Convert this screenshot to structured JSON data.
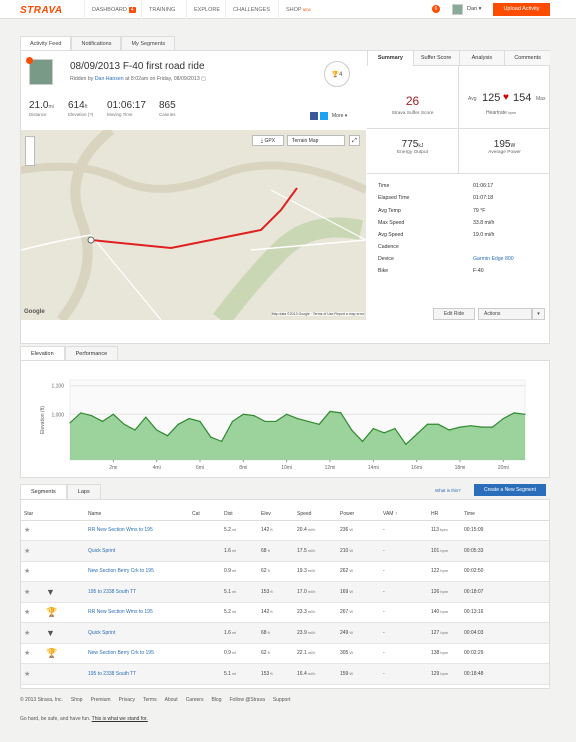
{
  "header": {
    "logo": "STRAVA",
    "nav": [
      "DASHBOARD",
      "TRAINING",
      "EXPLORE",
      "CHALLENGES",
      "SHOP"
    ],
    "dashboard_badge": "4",
    "shop_badge": "NEW",
    "notifications": "6",
    "user": "Dan ▾",
    "upload": "Upload Activity"
  },
  "tabs": [
    "Activity Feed",
    "Notifications",
    "My Segments"
  ],
  "activity": {
    "title": "08/09/2013 F-40 first road ride",
    "ridden_by_prefix": "Ridden by",
    "rider": "Dan Hansen",
    "ridden_by_suffix": "at 8:02am on Friday, 08/09/2013",
    "kudos": "4",
    "more": "More ▾",
    "stats": [
      {
        "value": "21.0",
        "unit": "mi",
        "label": "Distance"
      },
      {
        "value": "614",
        "unit": "ft",
        "label": "Elevation (?)"
      },
      {
        "value": "01:06:17",
        "unit": "",
        "label": "Moving Time"
      },
      {
        "value": "865",
        "unit": "",
        "label": "Calories"
      }
    ]
  },
  "map": {
    "gpx": "GPX",
    "type": "Terrain Map",
    "copyright": "Map data ©2013 Google · Terms of Use   Report a map error",
    "google": "Google"
  },
  "right_tabs": [
    "Summary",
    "Suffer Score",
    "Analysis",
    "Comments"
  ],
  "summary": {
    "suffer": "26",
    "suffer_label": "Strava Suffer Score",
    "hr_avg_label": "Avg",
    "hr_avg": "125",
    "hr_max": "154",
    "hr_max_label": "Max",
    "hr_label": "Heartrate",
    "hr_unit": "bpm",
    "energy": "775",
    "energy_unit": "kJ",
    "energy_label": "Energy Output",
    "power": "195",
    "power_unit": "W",
    "power_label": "Average Power",
    "rows": [
      {
        "k": "Time",
        "v": "01:06:17"
      },
      {
        "k": "Elapsed Time",
        "v": "01:07:18"
      },
      {
        "k": "Avg Temp",
        "v": "79 °F"
      },
      {
        "k": "Max Speed",
        "v": "33.8 mi/h"
      },
      {
        "k": "Avg Speed",
        "v": "19.0 mi/h"
      },
      {
        "k": "Cadence",
        "v": ""
      },
      {
        "k": "Device",
        "v": "Garmin Edge 800"
      },
      {
        "k": "Bike",
        "v": "F-40"
      }
    ],
    "edit": "Edit Ride",
    "actions": "Actions"
  },
  "bottom_tabs": [
    "Elevation",
    "Performance"
  ],
  "chart_data": {
    "type": "area",
    "ylabel": "Elevation (ft)",
    "yticks": [
      "1,100",
      "1,000"
    ],
    "xticks": [
      "2mi",
      "4mi",
      "6mi",
      "8mi",
      "10mi",
      "12mi",
      "14mi",
      "16mi",
      "18mi",
      "20mi"
    ],
    "ylim": [
      840,
      1120
    ],
    "x": [
      0,
      0.5,
      1,
      1.5,
      2,
      2.5,
      3,
      3.5,
      4,
      4.5,
      5,
      5.5,
      6,
      6.5,
      7,
      7.5,
      8,
      8.5,
      9,
      9.5,
      10,
      10.5,
      11,
      11.5,
      12,
      12.5,
      13,
      13.5,
      14,
      14.5,
      15,
      15.5,
      16,
      16.5,
      17,
      17.5,
      18,
      18.5,
      19,
      19.5,
      20,
      20.5,
      21
    ],
    "y": [
      970,
      1005,
      995,
      975,
      1000,
      965,
      945,
      990,
      945,
      925,
      965,
      985,
      975,
      920,
      905,
      975,
      1000,
      995,
      975,
      975,
      1000,
      985,
      975,
      965,
      1010,
      1005,
      945,
      905,
      950,
      935,
      950,
      895,
      930,
      965,
      965,
      945,
      955,
      960,
      955,
      955,
      985,
      1005,
      1000
    ]
  },
  "segments": {
    "tabs": [
      "Segments",
      "Laps"
    ],
    "what": "What is this?",
    "create": "Create a New Segment",
    "columns": [
      "Star",
      "",
      "Name",
      "Cat",
      "Dist",
      "Elev",
      "Speed",
      "Power",
      "VAM ↑",
      "HR",
      "Time"
    ],
    "rows": [
      {
        "medal": "",
        "name": "RR New Section Wms to 195",
        "dist": "5.2",
        "elev": "142",
        "speed": "20.4",
        "power": "236",
        "vam": "-",
        "hr": "113",
        "time": "00:15:09"
      },
      {
        "medal": "",
        "name": "Quick Sprint",
        "dist": "1.6",
        "elev": "68",
        "speed": "17.5",
        "power": "210",
        "vam": "-",
        "hr": "101",
        "time": "00:05:33"
      },
      {
        "medal": "",
        "name": "New Section Berry Crk to 195",
        "dist": "0.9",
        "elev": "62",
        "speed": "19.3",
        "power": "262",
        "vam": "-",
        "hr": "122",
        "time": "00:02:50"
      },
      {
        "medal": "silver",
        "name": "195 to 2338 South TT",
        "dist": "5.1",
        "elev": "153",
        "speed": "17.0",
        "power": "169",
        "vam": "-",
        "hr": "126",
        "time": "00:18:07"
      },
      {
        "medal": "gold",
        "name": "RR New Section Wms to 195",
        "dist": "5.2",
        "elev": "142",
        "speed": "23.3",
        "power": "267",
        "vam": "-",
        "hr": "140",
        "time": "00:13:16"
      },
      {
        "medal": "silver",
        "name": "Quick Sprint",
        "dist": "1.6",
        "elev": "68",
        "speed": "23.9",
        "power": "249",
        "vam": "-",
        "hr": "127",
        "time": "00:04:03"
      },
      {
        "medal": "gold",
        "name": "New Section Berry Crk to 195",
        "dist": "0.9",
        "elev": "62",
        "speed": "22.1",
        "power": "305",
        "vam": "-",
        "hr": "138",
        "time": "00:02:29"
      },
      {
        "medal": "",
        "name": "195 to 2338 South TT",
        "dist": "5.1",
        "elev": "153",
        "speed": "16.4",
        "power": "159",
        "vam": "-",
        "hr": "129",
        "time": "00:18:48"
      }
    ]
  },
  "footer": {
    "links": [
      "© 2013 Strava, Inc.",
      "Shop",
      "Premium",
      "Privacy",
      "Terms",
      "About",
      "Careers",
      "Blog",
      "Follow @Strava",
      "Support"
    ],
    "tagline": "Go hard, be safe, and have fun.",
    "tagline_link": "This is what we stand for."
  },
  "colors": {
    "brand": "#fc4c02",
    "chart": "#3a9a3a",
    "route": "#e02020"
  }
}
